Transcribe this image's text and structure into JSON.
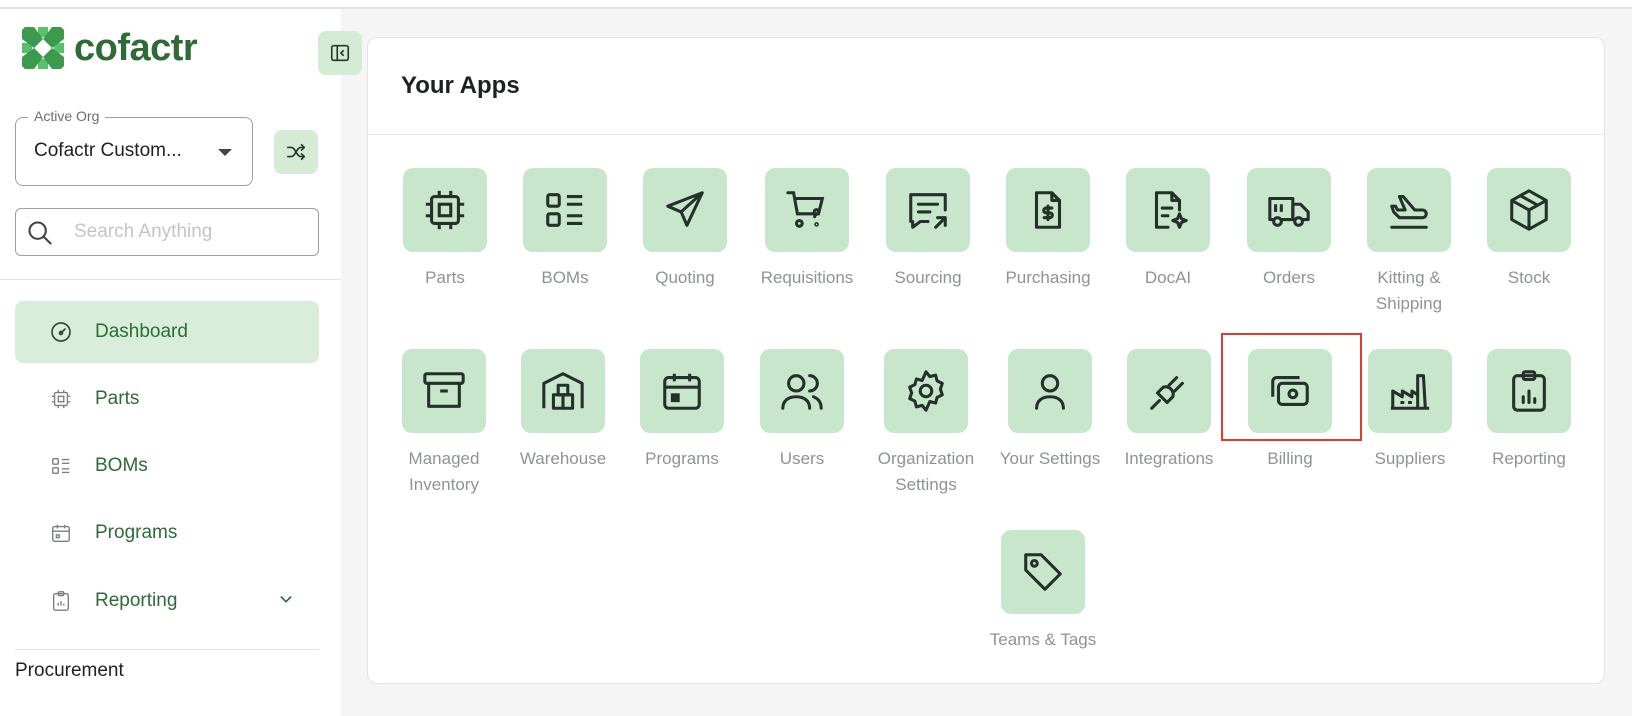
{
  "brand": {
    "name": "cofactr"
  },
  "sidebar": {
    "active_org": {
      "legend": "Active Org",
      "value": "Cofactr Custom..."
    },
    "search": {
      "placeholder": "Search Anything"
    },
    "items": [
      {
        "label": "Dashboard",
        "icon": "dashboard-icon",
        "active": true
      },
      {
        "label": "Parts",
        "icon": "chip-icon",
        "active": false
      },
      {
        "label": "BOMs",
        "icon": "list-icon",
        "active": false
      },
      {
        "label": "Programs",
        "icon": "calendar-icon",
        "active": false
      },
      {
        "label": "Reporting",
        "icon": "clipboard-icon",
        "active": false,
        "expandable": true
      }
    ],
    "section": "Procurement"
  },
  "main": {
    "title": "Your Apps",
    "apps": [
      {
        "label": "Parts",
        "icon": "chip-icon"
      },
      {
        "label": "BOMs",
        "icon": "list-icon"
      },
      {
        "label": "Quoting",
        "icon": "send-icon"
      },
      {
        "label": "Requisitions",
        "icon": "cart-question-icon"
      },
      {
        "label": "Sourcing",
        "icon": "message-arrow-icon"
      },
      {
        "label": "Purchasing",
        "icon": "file-dollar-icon"
      },
      {
        "label": "DocAI",
        "icon": "file-sparkle-icon"
      },
      {
        "label": "Orders",
        "icon": "truck-icon"
      },
      {
        "label": "Kitting & Shipping",
        "icon": "plane-icon"
      },
      {
        "label": "Stock",
        "icon": "box-icon"
      },
      {
        "label": "Managed Inventory",
        "icon": "archive-icon"
      },
      {
        "label": "Warehouse",
        "icon": "warehouse-icon"
      },
      {
        "label": "Programs",
        "icon": "calendar-icon"
      },
      {
        "label": "Users",
        "icon": "users-icon"
      },
      {
        "label": "Organization Settings",
        "icon": "gear-icon"
      },
      {
        "label": "Your Settings",
        "icon": "user-icon"
      },
      {
        "label": "Integrations",
        "icon": "plug-icon"
      },
      {
        "label": "Billing",
        "icon": "money-icon",
        "highlighted": true
      },
      {
        "label": "Suppliers",
        "icon": "factory-icon"
      },
      {
        "label": "Reporting",
        "icon": "clipboard-chart-icon"
      },
      {
        "label": "Teams & Tags",
        "icon": "tag-icon"
      }
    ]
  },
  "colors": {
    "brand": "#2f6b36",
    "tile": "#c8e6cc",
    "active_nav": "#d8eedb",
    "highlight": "#e03c2e"
  }
}
